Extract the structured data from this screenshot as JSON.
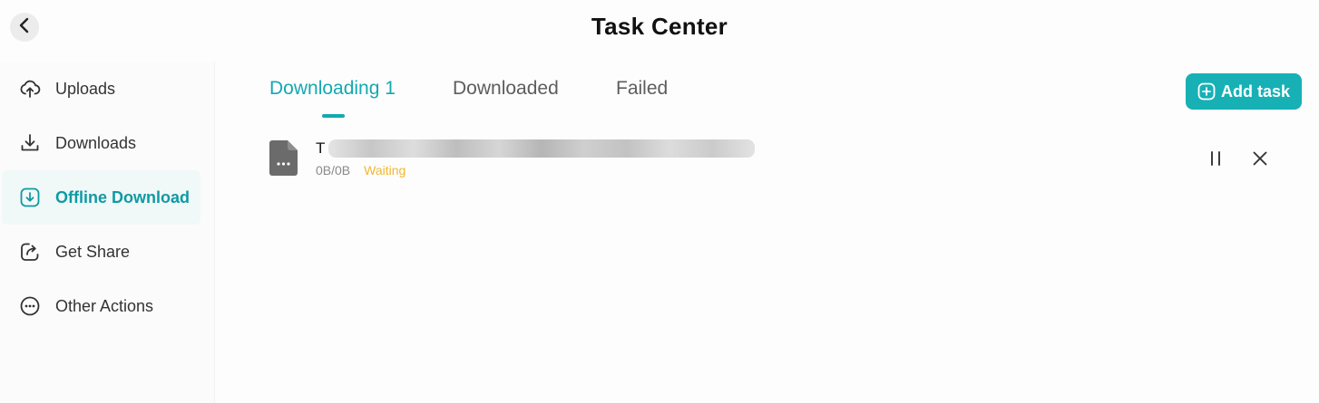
{
  "header": {
    "title": "Task Center",
    "back_icon": "chevron-left-icon"
  },
  "sidebar": {
    "active_color": "#0f9aa3",
    "items": [
      {
        "label": "Uploads",
        "icon": "upload-cloud-icon"
      },
      {
        "label": "Downloads",
        "icon": "download-icon"
      },
      {
        "label": "Offline Download",
        "icon": "offline-download-icon",
        "active": true
      },
      {
        "label": "Get Share",
        "icon": "share-icon"
      },
      {
        "label": "Other Actions",
        "icon": "more-circle-icon"
      }
    ]
  },
  "tabs": [
    {
      "label": "Downloading 1",
      "active": true
    },
    {
      "label": "Downloaded"
    },
    {
      "label": "Failed"
    }
  ],
  "toolbar": {
    "add_task_label": "Add task",
    "add_task_icon": "add-square-icon",
    "accent_color": "#17b0b5"
  },
  "tasks": [
    {
      "name_visible": "T",
      "size": "0B/0B",
      "status": "Waiting",
      "status_color": "#f0b731",
      "icon": "file-icon",
      "actions": [
        "pause-icon",
        "close-icon"
      ]
    }
  ]
}
